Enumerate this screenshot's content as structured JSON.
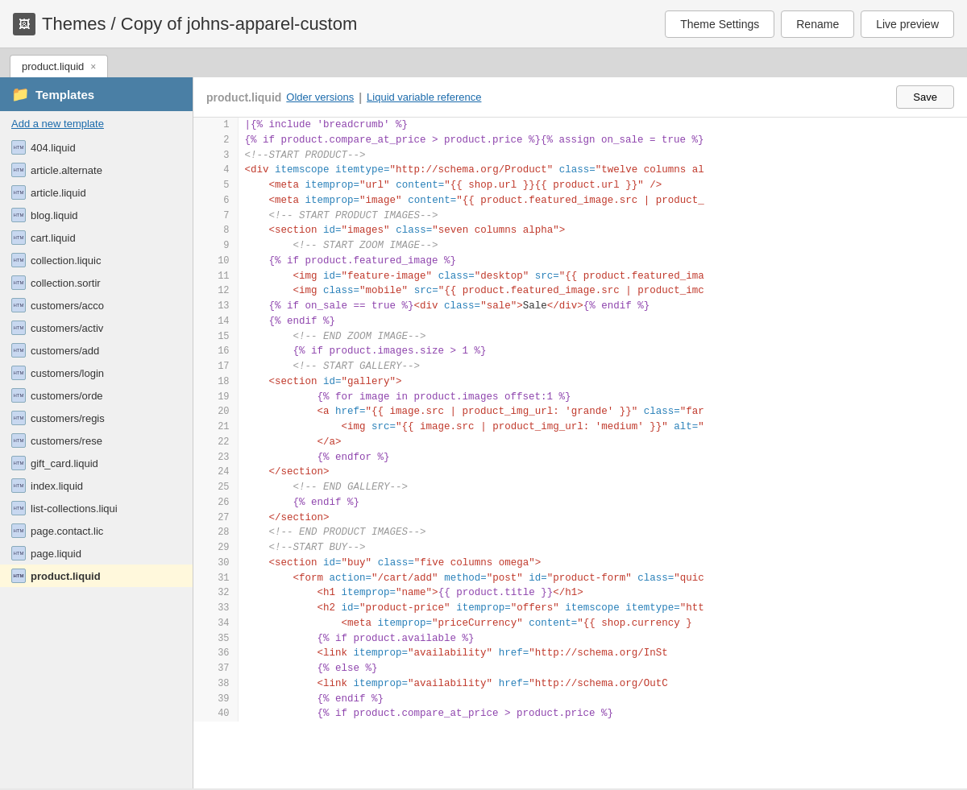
{
  "header": {
    "icon": "🖼",
    "title": "Themes / Copy of johns-apparel-custom",
    "theme_settings_label": "Theme Settings",
    "rename_label": "Rename",
    "live_preview_label": "Live preview"
  },
  "tab": {
    "label": "product.liquid",
    "close": "×"
  },
  "sidebar": {
    "title": "Templates",
    "add_template_label": "Add a new template",
    "items": [
      {
        "id": "404",
        "label": "404.liquid",
        "active": false
      },
      {
        "id": "article-alt",
        "label": "article.alternate",
        "active": false
      },
      {
        "id": "article",
        "label": "article.liquid",
        "active": false
      },
      {
        "id": "blog",
        "label": "blog.liquid",
        "active": false
      },
      {
        "id": "cart",
        "label": "cart.liquid",
        "active": false
      },
      {
        "id": "collection-liq",
        "label": "collection.liquic",
        "active": false
      },
      {
        "id": "collection-sort",
        "label": "collection.sortir",
        "active": false
      },
      {
        "id": "customers-acc",
        "label": "customers/acco",
        "active": false
      },
      {
        "id": "customers-act",
        "label": "customers/activ",
        "active": false
      },
      {
        "id": "customers-add",
        "label": "customers/add",
        "active": false
      },
      {
        "id": "customers-log",
        "label": "customers/login",
        "active": false
      },
      {
        "id": "customers-ord",
        "label": "customers/orde",
        "active": false
      },
      {
        "id": "customers-reg",
        "label": "customers/regis",
        "active": false
      },
      {
        "id": "customers-res",
        "label": "customers/rese",
        "active": false
      },
      {
        "id": "gift-card",
        "label": "gift_card.liquid",
        "active": false
      },
      {
        "id": "index",
        "label": "index.liquid",
        "active": false
      },
      {
        "id": "list-collections",
        "label": "list-collections.liqui",
        "active": false
      },
      {
        "id": "page-contact",
        "label": "page.contact.lic",
        "active": false
      },
      {
        "id": "page",
        "label": "page.liquid",
        "active": false
      },
      {
        "id": "product",
        "label": "product.liquid",
        "active": true
      }
    ]
  },
  "editor": {
    "filename": "product.liquid",
    "older_versions_label": "Older versions",
    "liquid_variable_label": "Liquid variable reference",
    "separator": "|",
    "save_label": "Save"
  }
}
